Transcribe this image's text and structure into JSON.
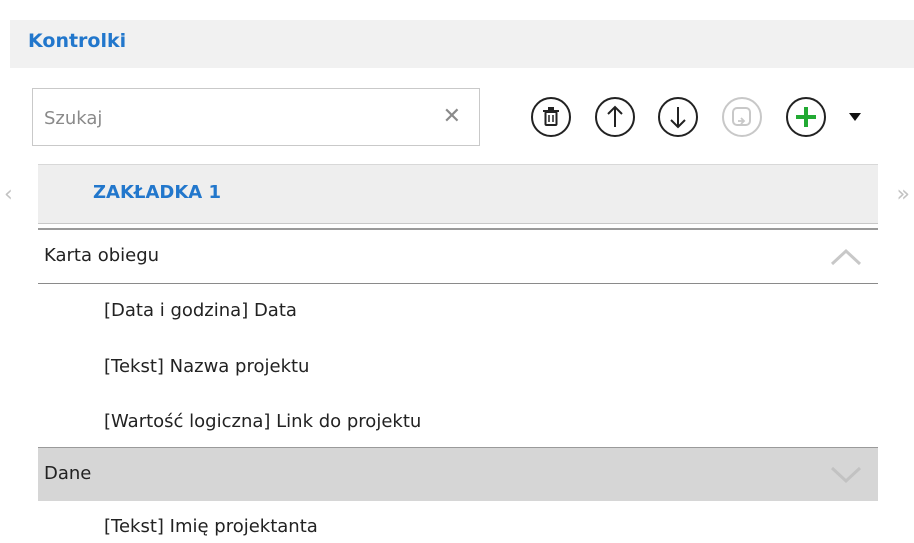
{
  "header": {
    "title": "Kontrolki"
  },
  "search": {
    "placeholder": "Szukaj",
    "value": "",
    "clear_glyph": "✕"
  },
  "toolbar": {
    "buttons": [
      {
        "name": "delete-button",
        "icon": "trash-icon"
      },
      {
        "name": "move-up-button",
        "icon": "arrow-up-icon"
      },
      {
        "name": "move-down-button",
        "icon": "arrow-down-icon"
      },
      {
        "name": "copy-button",
        "icon": "copy-icon",
        "disabled": true
      },
      {
        "name": "add-button",
        "icon": "plus-icon",
        "color": "#22aa33"
      }
    ],
    "dropdown_icon": "caret-down-icon"
  },
  "tabs": {
    "left_arrow": "‹",
    "right_arrow": "»",
    "items": [
      {
        "label": "ZAKŁADKA 1"
      }
    ]
  },
  "sections": [
    {
      "label": "Karta obiegu",
      "expanded": true,
      "items": [
        {
          "label": "[Data i godzina] Data"
        },
        {
          "label": "[Tekst] Nazwa projektu"
        },
        {
          "label": "[Wartość logiczna] Link do projektu"
        }
      ]
    },
    {
      "label": "Dane",
      "expanded": true,
      "selected": true,
      "items": [
        {
          "label": "[Tekst] Imię projektanta"
        }
      ]
    }
  ],
  "colors": {
    "accent": "#2277cc",
    "add": "#22aa33",
    "selected_row": "#d6d6d6"
  }
}
